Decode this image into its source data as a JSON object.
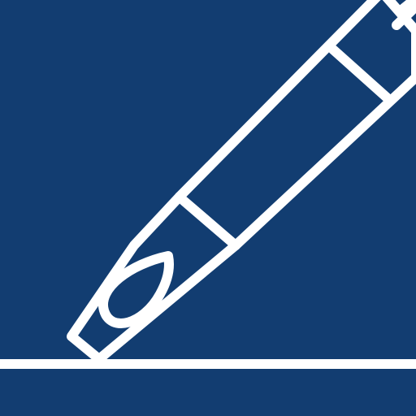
{
  "icon": {
    "name": "pen-icon",
    "background_color": "#123d71",
    "stroke_color": "#ffffff"
  }
}
